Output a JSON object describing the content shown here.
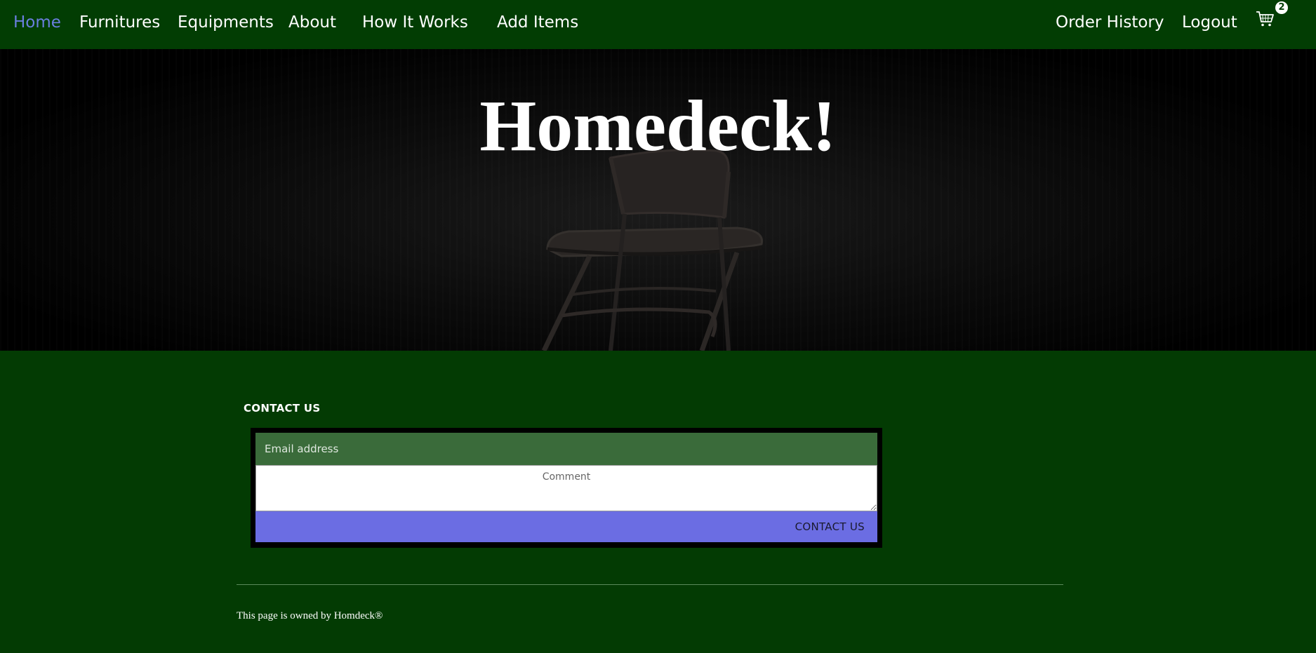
{
  "nav": {
    "left_links": [
      {
        "label": "Home",
        "active": true
      },
      {
        "label": "Furnitures"
      },
      {
        "label": "Equipments"
      },
      {
        "label": "About"
      },
      {
        "label": "How It Works"
      },
      {
        "label": "Add Items"
      }
    ],
    "right_links": [
      {
        "label": "Order History"
      },
      {
        "label": "Logout"
      }
    ],
    "cart": {
      "icon": "cart-icon",
      "count": "2"
    }
  },
  "hero": {
    "title": "Homedeck!",
    "background_image": "folding-chair-image"
  },
  "contact": {
    "heading": "CONTACT US",
    "email_placeholder": "Email address",
    "comment_placeholder": "Comment",
    "submit_label": "CONTACT US"
  },
  "footer": {
    "text": "This page is owned by Homdeck®"
  },
  "colors": {
    "navbar": "#023d03",
    "page_background": "#033b03",
    "active_link": "#6b7fe0",
    "email_field": "#3a6b3a",
    "submit_button": "#6b6de3"
  }
}
